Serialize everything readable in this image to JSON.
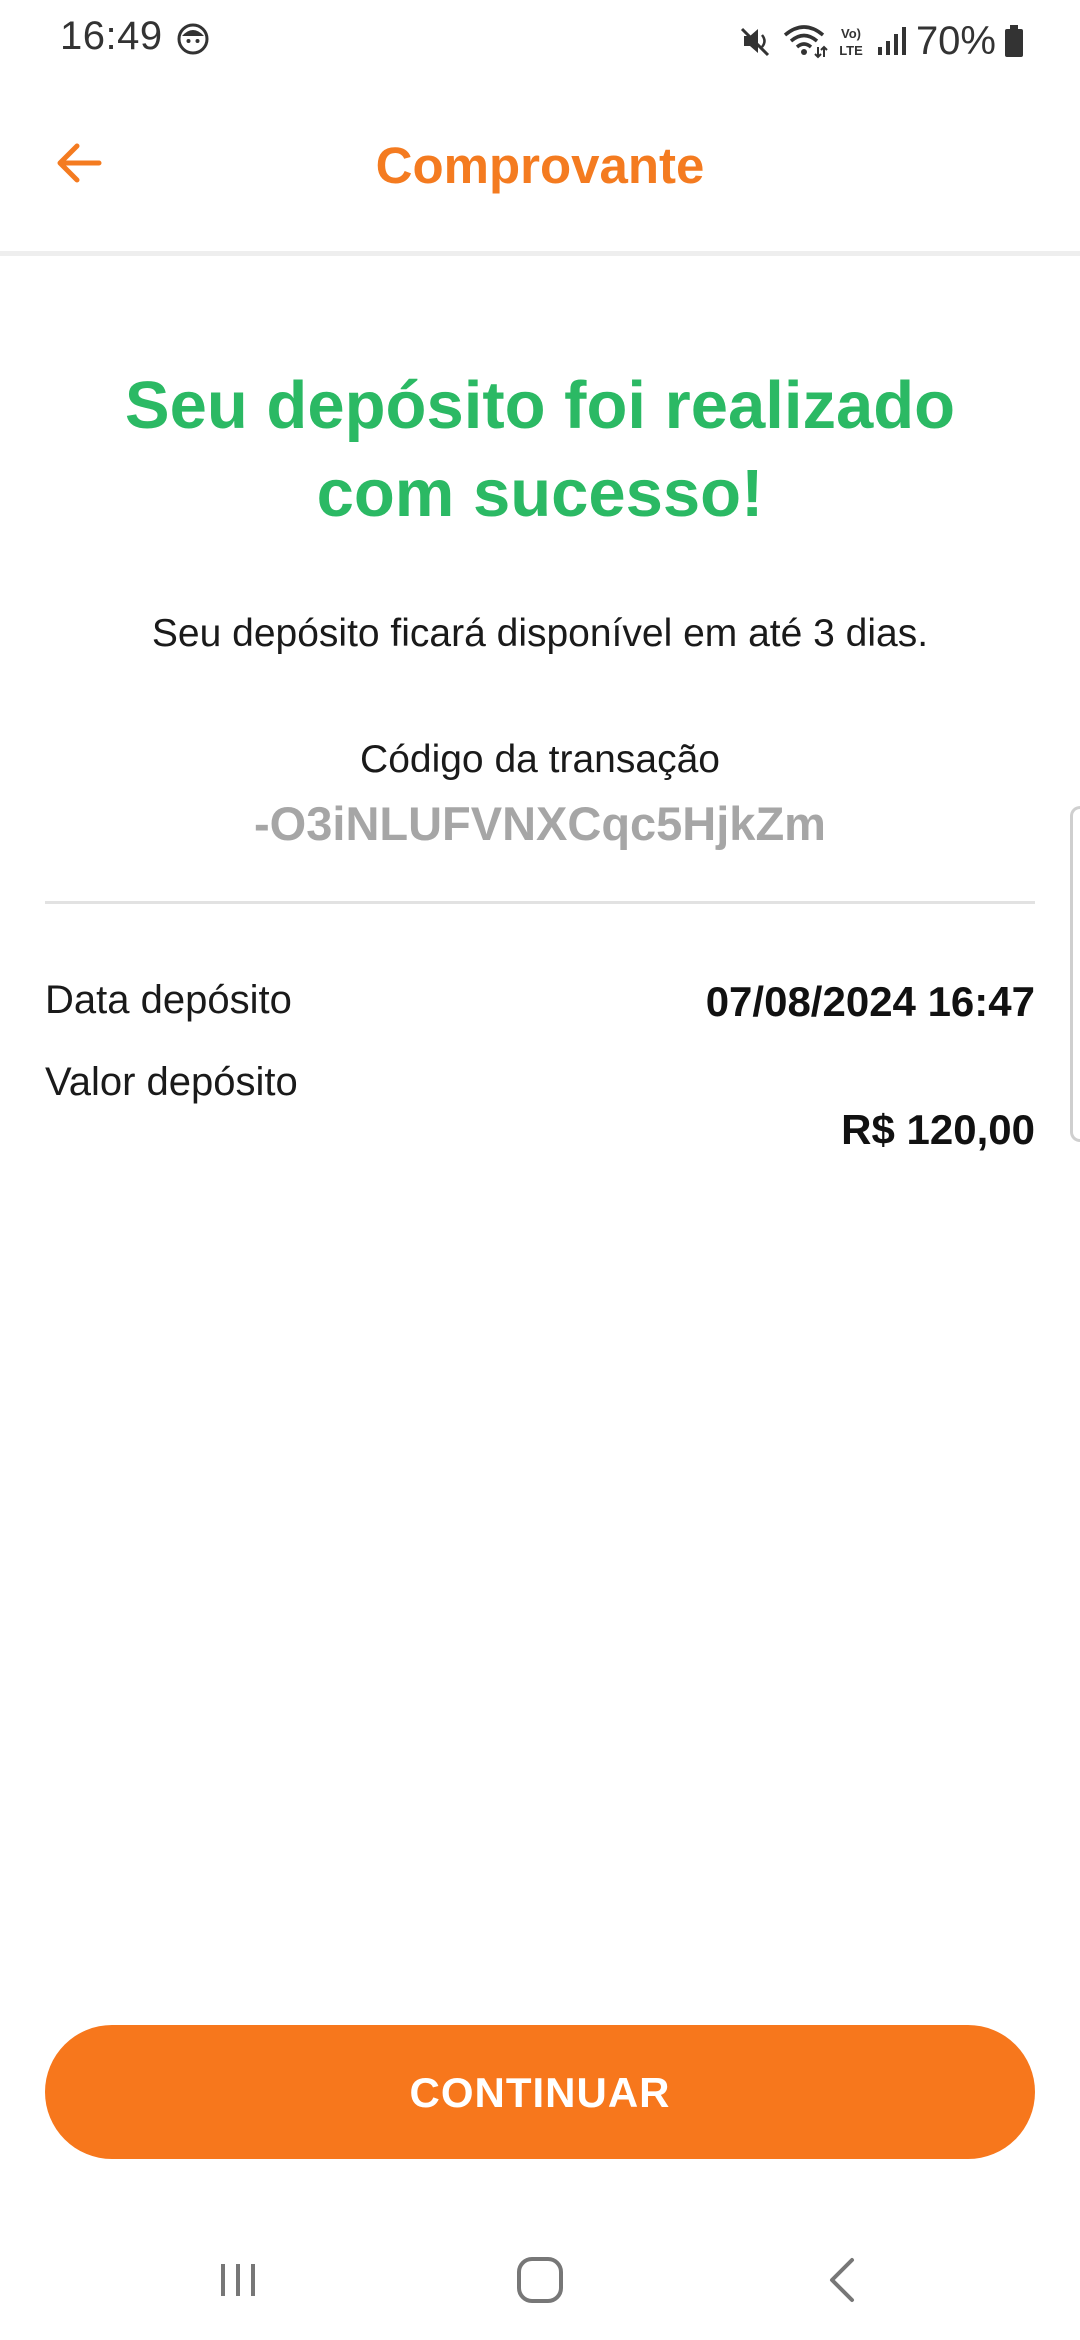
{
  "status_bar": {
    "time": "16:49",
    "battery": "70%",
    "icons": [
      "face-icon",
      "mute-icon",
      "wifi-icon",
      "volte-icon",
      "signal-icon",
      "battery-icon"
    ]
  },
  "header": {
    "title": "Comprovante",
    "back_icon": "arrow-left-icon"
  },
  "receipt": {
    "success_line1": "Seu depósito foi realizado",
    "success_line2": "com sucesso!",
    "availability": "Seu depósito ficará disponível em até 3 dias.",
    "transaction_label": "Código da transação",
    "transaction_code": "-O3iNLUFVNXCqc5HjkZm",
    "details": [
      {
        "label": "Data depósito",
        "value": "07/08/2024 16:47"
      },
      {
        "label": "Valor depósito",
        "value": "R$ 120,00"
      }
    ]
  },
  "actions": {
    "continue_label": "CONTINUAR"
  },
  "nav_bar": {
    "icons": [
      "recent-apps-icon",
      "home-icon",
      "back-icon"
    ]
  },
  "colors": {
    "accent": "#f47b20",
    "button": "#f7771c",
    "success": "#2bb964",
    "code": "#a6a6a6"
  }
}
